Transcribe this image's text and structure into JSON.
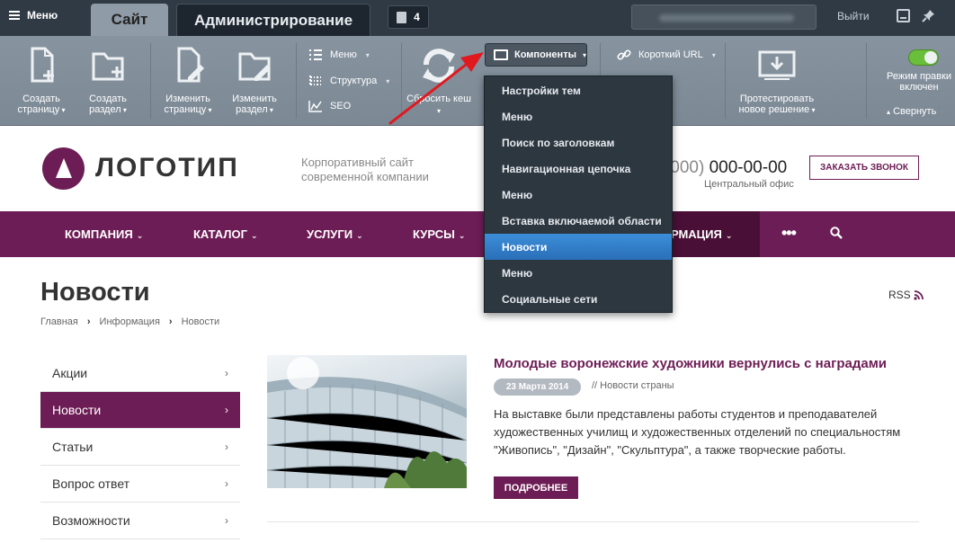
{
  "topbar": {
    "menu_label": "Меню",
    "tabs": [
      {
        "label": "Сайт"
      },
      {
        "label": "Администрирование"
      }
    ],
    "notification_count": "4",
    "logout_label": "Выйти"
  },
  "toolbar": {
    "create_page": "Создать страницу",
    "create_section": "Создать раздел",
    "edit_page": "Изменить страницу",
    "edit_section": "Изменить раздел",
    "menu": "Меню",
    "structure": "Структура",
    "seo": "SEO",
    "reset_cache": "Сбросить кеш",
    "components": "Компоненты",
    "short_url": "Короткий URL",
    "test_solution": "Протестировать новое решение",
    "edit_mode": "Режим правки включен",
    "collapse": "Свернуть"
  },
  "components_menu": [
    {
      "label": "Настройки тем"
    },
    {
      "label": "Меню"
    },
    {
      "label": "Поиск по заголовкам"
    },
    {
      "label": "Навигационная цепочка"
    },
    {
      "label": "Меню"
    },
    {
      "label": "Вставка включаемой области"
    },
    {
      "label": "Новости"
    },
    {
      "label": "Меню"
    },
    {
      "label": "Социальные сети"
    }
  ],
  "header": {
    "logo_text": "ЛОГОТИП",
    "slogan": "Корпоративный сайт современной компании",
    "phone_code": "+7 (000)",
    "phone_number": "000-00-00",
    "office": "Центральный офис",
    "callback": "ЗАКАЗАТЬ ЗВОНОК"
  },
  "nav": {
    "items": [
      {
        "label": "КОМПАНИЯ"
      },
      {
        "label": "КАТАЛОГ"
      },
      {
        "label": "УСЛУГИ"
      },
      {
        "label": "КУРСЫ"
      },
      {
        "label": "ИНФОРМАЦИЯ"
      }
    ],
    "more": "•••"
  },
  "page": {
    "title": "Новости",
    "rss": "RSS",
    "breadcrumb": [
      "Главная",
      "Информация",
      "Новости"
    ]
  },
  "sidebar": {
    "items": [
      {
        "label": "Акции"
      },
      {
        "label": "Новости"
      },
      {
        "label": "Статьи"
      },
      {
        "label": "Вопрос ответ"
      },
      {
        "label": "Возможности"
      }
    ],
    "active": "Новости"
  },
  "news": {
    "title": "Молодые воронежские художники вернулись с наградами",
    "date": "23 Марта 2014",
    "category": "// Новости страны",
    "text": "На выставке были представлены работы студентов и преподавателей художественных училищ и художественных отделений по специальностям \"Живопись\", \"Дизайн\", \"Скульптура\", а также творческие работы.",
    "more": "ПОДРОБНЕЕ"
  },
  "colors": {
    "brand": "#6d1d55",
    "admin_bar": "#2f3a45",
    "toolbar": "#8794a0",
    "dropdown": "#2d3740",
    "dropdown_active": "#2a6fb8",
    "annotation_arrow": "#e0191f"
  }
}
